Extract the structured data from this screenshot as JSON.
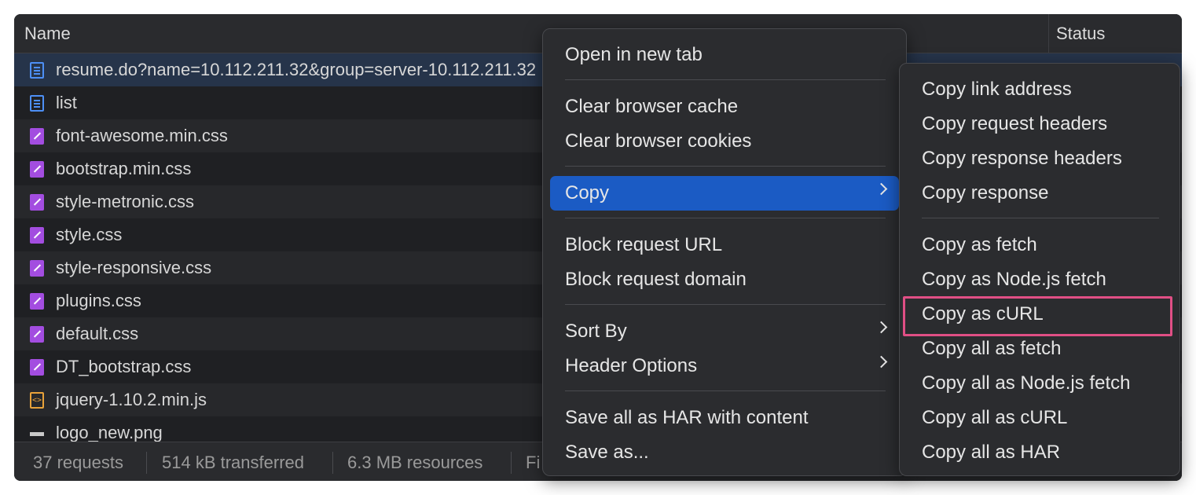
{
  "table": {
    "columns": {
      "name": "Name",
      "status": "Status"
    },
    "rows": [
      {
        "name": "resume.do?name=10.112.211.32&group=server-10.112.211.32",
        "type": "doc"
      },
      {
        "name": "list",
        "type": "doc"
      },
      {
        "name": "font-awesome.min.css",
        "type": "css"
      },
      {
        "name": "bootstrap.min.css",
        "type": "css"
      },
      {
        "name": "style-metronic.css",
        "type": "css"
      },
      {
        "name": "style.css",
        "type": "css"
      },
      {
        "name": "style-responsive.css",
        "type": "css"
      },
      {
        "name": "plugins.css",
        "type": "css"
      },
      {
        "name": "default.css",
        "type": "css"
      },
      {
        "name": "DT_bootstrap.css",
        "type": "css"
      },
      {
        "name": "jquery-1.10.2.min.js",
        "type": "js"
      },
      {
        "name": "logo_new.png",
        "type": "img"
      }
    ]
  },
  "footer": {
    "requests": "37 requests",
    "transferred": "514 kB transferred",
    "resources": "6.3 MB resources",
    "finish": "Fi"
  },
  "context_menu": {
    "items": [
      {
        "label": "Open in new tab"
      },
      {
        "label": "Clear browser cache"
      },
      {
        "label": "Clear browser cookies"
      },
      {
        "label": "Copy",
        "submenu": true,
        "highlighted": true
      },
      {
        "label": "Block request URL"
      },
      {
        "label": "Block request domain"
      },
      {
        "label": "Sort By",
        "submenu": true
      },
      {
        "label": "Header Options",
        "submenu": true
      },
      {
        "label": "Save all as HAR with content"
      },
      {
        "label": "Save as..."
      }
    ]
  },
  "copy_submenu": {
    "items": [
      {
        "label": "Copy link address"
      },
      {
        "label": "Copy request headers"
      },
      {
        "label": "Copy response headers"
      },
      {
        "label": "Copy response"
      },
      {
        "label": "Copy as fetch"
      },
      {
        "label": "Copy as Node.js fetch"
      },
      {
        "label": "Copy as cURL",
        "annotated": true
      },
      {
        "label": "Copy all as fetch"
      },
      {
        "label": "Copy all as Node.js fetch"
      },
      {
        "label": "Copy all as cURL"
      },
      {
        "label": "Copy all as HAR"
      }
    ]
  },
  "colors": {
    "panel_bg": "#1f2023",
    "menu_bg": "#2b2c2f",
    "highlight": "#1b5bc4",
    "annotation_box": "#e04f85"
  }
}
